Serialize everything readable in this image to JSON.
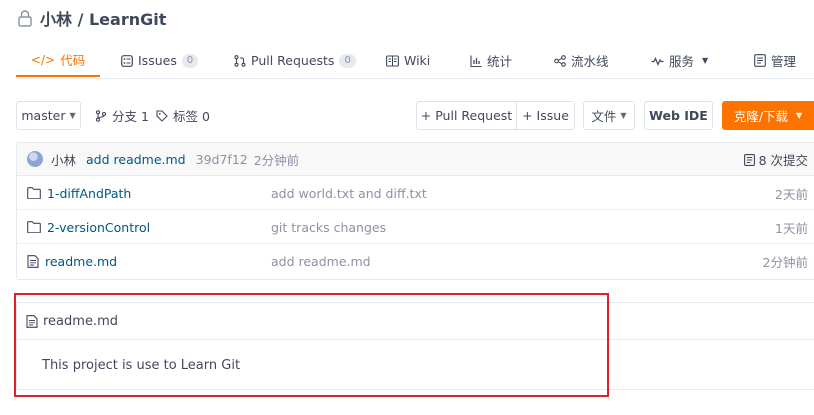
{
  "repo": {
    "title": "小林 / LearnGit",
    "icon": "lock-icon"
  },
  "tabs": [
    {
      "label": "代码",
      "icon": "code-icon",
      "active": true
    },
    {
      "label": "Issues",
      "count": "0",
      "icon": "issues-icon"
    },
    {
      "label": "Pull Requests",
      "count": "0",
      "icon": "pull-request-icon"
    },
    {
      "label": "Wiki",
      "icon": "wiki-icon"
    },
    {
      "label": "统计",
      "icon": "stats-icon"
    },
    {
      "label": "流水线",
      "icon": "pipeline-icon"
    },
    {
      "label": "服务",
      "icon": "service-icon"
    },
    {
      "label": "管理",
      "icon": "manage-icon"
    }
  ],
  "toolbar": {
    "branch": "master",
    "branches": "分支 1",
    "tags": "标签 0",
    "pull_request": "+ Pull Request",
    "issue": "+ Issue",
    "files": "文件",
    "web_ide": "Web IDE",
    "clone": "克隆/下载"
  },
  "commit": {
    "author": "小林",
    "message": "add readme.md",
    "sha": "39d7f12",
    "time": "2分钟前",
    "count": "8 次提交"
  },
  "files": [
    {
      "name": "1-diffAndPath",
      "type": "folder",
      "message": "add world.txt and diff.txt",
      "time": "2天前"
    },
    {
      "name": "2-versionControl",
      "type": "folder",
      "message": "git tracks changes",
      "time": "1天前"
    },
    {
      "name": "readme.md",
      "type": "file",
      "message": "add readme.md",
      "time": "2分钟前"
    }
  ],
  "readme": {
    "filename": "readme.md",
    "content": "This project is use to Learn Git"
  },
  "colors": {
    "accent": "#fe7300",
    "link": "#005980",
    "highlight": "#e0212c"
  }
}
